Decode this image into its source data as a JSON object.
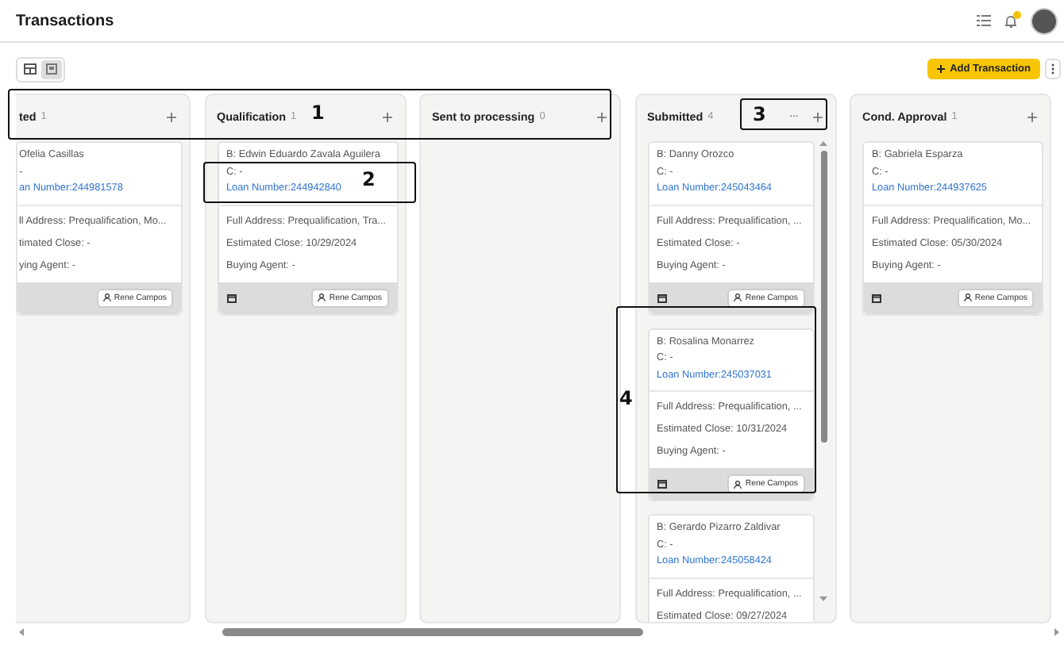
{
  "header": {
    "title": "Transactions"
  },
  "toolbar": {
    "views": [
      {
        "kind": "table",
        "selected": false
      },
      {
        "kind": "board",
        "selected": true
      }
    ],
    "add_button": "Add Transaction"
  },
  "columns": [
    {
      "title": "ted",
      "count": "1",
      "cut_left": true,
      "cards": [
        {
          "borrower": "Ofelia Casillas",
          "co": "-",
          "loan": "an Number:244981578",
          "details": [
            "ll Address: Prequalification, Mo...",
            "timated Close: -",
            "ying Agent: -"
          ],
          "owner": "Rene Campos"
        }
      ]
    },
    {
      "title": "Qualification",
      "count": "1",
      "cards": [
        {
          "borrower": "B: Edwin Eduardo Zavala Aguilera",
          "co": "C: -",
          "loan": "Loan Number:244942840",
          "details": [
            "Full Address: Prequalification, Tra...",
            "Estimated Close: 10/29/2024",
            "Buying Agent: -"
          ],
          "owner": "Rene Campos"
        }
      ]
    },
    {
      "title": "Sent to processing",
      "count": "0"
    },
    {
      "title": "Submitted",
      "count": "4",
      "menu_icon": "···",
      "scrollable": true,
      "cards": [
        {
          "borrower": "B: Danny Orozco",
          "co": "C: -",
          "loan": "Loan Number:245043464",
          "details": [
            "Full Address: Prequalification, ...",
            "Estimated Close: -",
            "Buying Agent: -"
          ],
          "owner": "Rene Campos"
        },
        {
          "borrower": "B: Rosalina Monarrez",
          "co": "C: -",
          "loan": "Loan Number:245037031",
          "details": [
            "Full Address: Prequalification, ...",
            "Estimated Close: 10/31/2024",
            "Buying Agent: -"
          ],
          "owner": "Rene Campos"
        },
        {
          "borrower": "B: Gerardo Pizarro Zaldivar",
          "co": "C: -",
          "loan": "Loan Number:245058424",
          "details": [
            "Full Address: Prequalification, ...",
            "Estimated Close: 09/27/2024"
          ]
        }
      ]
    },
    {
      "title": "Cond. Approval",
      "count": "1",
      "cards": [
        {
          "borrower": "B: Gabriela Esparza",
          "co": "C: -",
          "loan": "Loan Number:244937625",
          "details": [
            "Full Address: Prequalification, Mo...",
            "Estimated Close: 05/30/2024",
            "Buying Agent: -"
          ],
          "owner": "Rene Campos"
        }
      ]
    }
  ],
  "annotations": [
    {
      "label": "1"
    },
    {
      "label": "2"
    },
    {
      "label": "3"
    },
    {
      "label": "4"
    }
  ]
}
